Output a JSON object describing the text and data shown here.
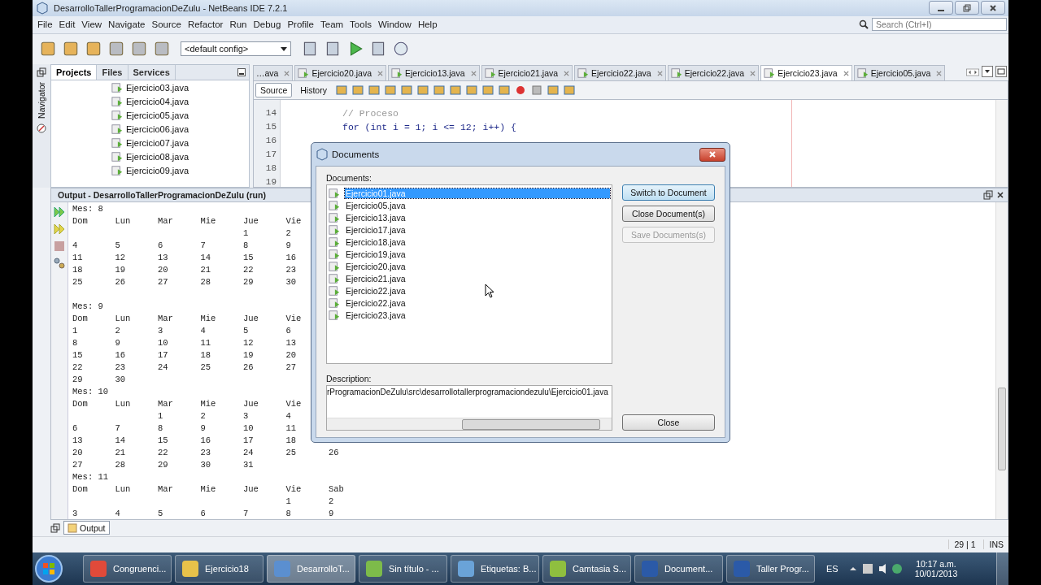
{
  "window": {
    "title": "DesarrolloTallerProgramacionDeZulu - NetBeans IDE 7.2.1"
  },
  "menu": [
    "File",
    "Edit",
    "View",
    "Navigate",
    "Source",
    "Refactor",
    "Run",
    "Debug",
    "Profile",
    "Team",
    "Tools",
    "Window",
    "Help"
  ],
  "search": {
    "placeholder": "Search (Ctrl+I)"
  },
  "config": {
    "value": "<default config>"
  },
  "navigator": {
    "label": "Navigator"
  },
  "panel_tabs": [
    {
      "label": "Projects",
      "selected": true
    },
    {
      "label": "Files",
      "selected": false
    },
    {
      "label": "Services",
      "selected": false
    }
  ],
  "project_files": [
    "Ejercicio03.java",
    "Ejercicio04.java",
    "Ejercicio05.java",
    "Ejercicio06.java",
    "Ejercicio07.java",
    "Ejercicio08.java",
    "Ejercicio09.java"
  ],
  "editor_tabs": [
    {
      "label": "…ava",
      "selected": false
    },
    {
      "label": "Ejercicio20.java",
      "selected": false
    },
    {
      "label": "Ejercicio13.java",
      "selected": false
    },
    {
      "label": "Ejercicio21.java",
      "selected": false
    },
    {
      "label": "Ejercicio22.java",
      "selected": false
    },
    {
      "label": "Ejercicio22.java",
      "selected": false
    },
    {
      "label": "Ejercicio23.java",
      "selected": true
    },
    {
      "label": "Ejercicio05.java",
      "selected": false
    }
  ],
  "view_tabs": [
    {
      "label": "Source",
      "selected": true
    },
    {
      "label": "History",
      "selected": false
    }
  ],
  "code_lines": [
    {
      "number": "14",
      "kind": "comment",
      "text": "// Proceso"
    },
    {
      "number": "15",
      "kind": "code",
      "text": "for (int i = 1; i <= 12; i++) {"
    },
    {
      "number": "16",
      "kind": "blank"
    },
    {
      "number": "17",
      "kind": "blank"
    },
    {
      "number": "18",
      "kind": "blank"
    },
    {
      "number": "19",
      "kind": "blank"
    }
  ],
  "output": {
    "title": "Output - DesarrolloTallerProgramacionDeZulu (run)",
    "rows": [
      [
        "Mes: 8"
      ],
      [
        "Dom",
        "Lun",
        "Mar",
        "Mie",
        "Jue",
        "Vie"
      ],
      [
        null,
        null,
        null,
        null,
        "1",
        "2"
      ],
      [
        "4",
        "5",
        "6",
        "7",
        "8",
        "9"
      ],
      [
        "11",
        "12",
        "13",
        "14",
        "15",
        "16"
      ],
      [
        "18",
        "19",
        "20",
        "21",
        "22",
        "23"
      ],
      [
        "25",
        "26",
        "27",
        "28",
        "29",
        "30"
      ],
      [],
      [
        "Mes: 9"
      ],
      [
        "Dom",
        "Lun",
        "Mar",
        "Mie",
        "Jue",
        "Vie"
      ],
      [
        "1",
        "2",
        "3",
        "4",
        "5",
        "6"
      ],
      [
        "8",
        "9",
        "10",
        "11",
        "12",
        "13"
      ],
      [
        "15",
        "16",
        "17",
        "18",
        "19",
        "20"
      ],
      [
        "22",
        "23",
        "24",
        "25",
        "26",
        "27"
      ],
      [
        "29",
        "30"
      ],
      [
        "Mes: 10"
      ],
      [
        "Dom",
        "Lun",
        "Mar",
        "Mie",
        "Jue",
        "Vie"
      ],
      [
        null,
        null,
        "1",
        "2",
        "3",
        "4"
      ],
      [
        "6",
        "7",
        "8",
        "9",
        "10",
        "11"
      ],
      [
        "13",
        "14",
        "15",
        "16",
        "17",
        "18"
      ],
      [
        "20",
        "21",
        "22",
        "23",
        "24",
        "25",
        "26"
      ],
      [
        "27",
        "28",
        "29",
        "30",
        "31"
      ],
      [
        "Mes: 11"
      ],
      [
        "Dom",
        "Lun",
        "Mar",
        "Mie",
        "Jue",
        "Vie",
        "Sab"
      ],
      [
        null,
        null,
        null,
        null,
        null,
        "1",
        "2"
      ],
      [
        "3",
        "4",
        "5",
        "6",
        "7",
        "8",
        "9"
      ]
    ]
  },
  "output_tab": {
    "label": "Output"
  },
  "status": {
    "position": "29 | 1",
    "mode": "INS"
  },
  "dialog": {
    "title": "Documents",
    "list_label": "Documents:",
    "documents": [
      {
        "name": "Ejercicio01.java",
        "selected": true
      },
      {
        "name": "Ejercicio05.java",
        "selected": false
      },
      {
        "name": "Ejercicio13.java",
        "selected": false
      },
      {
        "name": "Ejercicio17.java",
        "selected": false
      },
      {
        "name": "Ejercicio18.java",
        "selected": false
      },
      {
        "name": "Ejercicio19.java",
        "selected": false
      },
      {
        "name": "Ejercicio20.java",
        "selected": false
      },
      {
        "name": "Ejercicio21.java",
        "selected": false
      },
      {
        "name": "Ejercicio22.java",
        "selected": false
      },
      {
        "name": "Ejercicio22.java",
        "selected": false
      },
      {
        "name": "Ejercicio23.java",
        "selected": false
      }
    ],
    "buttons": [
      {
        "label": "Switch to Document",
        "disabled": false
      },
      {
        "label": "Close Document(s)",
        "disabled": false
      },
      {
        "label": "Save Documents(s)",
        "disabled": true
      }
    ],
    "description_label": "Description:",
    "description": "rProgramacionDeZulu\\src\\desarrollotallerprogramaciondezulu\\Ejercicio01.java",
    "close_button": "Close"
  },
  "taskbar": {
    "items": [
      {
        "label": "Congruenci...",
        "selected": false
      },
      {
        "label": "Ejercicio18",
        "selected": false
      },
      {
        "label": "DesarrolloT...",
        "selected": true
      },
      {
        "label": "Sin título - ...",
        "selected": false
      },
      {
        "label": "Etiquetas: B...",
        "selected": false
      },
      {
        "label": "Camtasia S...",
        "selected": false
      },
      {
        "label": "Document...",
        "selected": false
      },
      {
        "label": "Taller Progr...",
        "selected": false
      }
    ],
    "language": "ES",
    "time": "10:17 a.m.",
    "date": "10/01/2013"
  }
}
